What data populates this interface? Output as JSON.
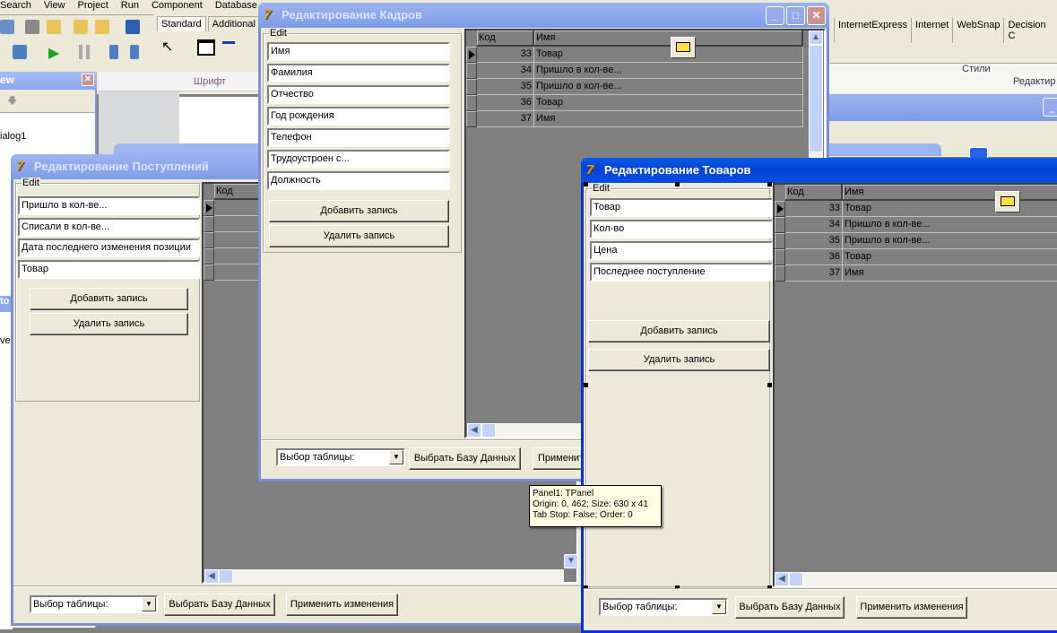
{
  "ide": {
    "menu": [
      "Search",
      "View",
      "Project",
      "Run",
      "Component",
      "Database"
    ],
    "palette_tabs": [
      "Standard",
      "Additional"
    ],
    "palette_tabs_right": [
      "InternetExpress",
      "Internet",
      "WebSnap",
      "Decision C"
    ],
    "tree_title": "ew",
    "tree_item": "ialog1",
    "font_label": "Шрифт",
    "styles_label": "Стили",
    "edit_label": "Редактир",
    "left_fragment_1": "to",
    "left_fragment_2": "ver"
  },
  "windows": {
    "postupleniya": {
      "title": "Редактирование Поступлений",
      "group_label": "Edit",
      "fields": [
        "Пришло в кол-ве...",
        "Списали в кол-ве...",
        "Дата последнего изменения позиции",
        "Товар"
      ],
      "add_button": "Добавить запись",
      "delete_button": "Удалить запись",
      "grid": {
        "columns": [
          "Код"
        ],
        "rows": [
          [
            ""
          ],
          [
            ""
          ],
          [
            ""
          ],
          [
            ""
          ],
          [
            ""
          ]
        ]
      },
      "table_select": "Выбор таблицы:",
      "select_db_button": "Выбрать Базу Данных",
      "apply_button": "Применить изменения"
    },
    "kadry": {
      "title": "Редактирование Кадров",
      "group_label": "Edit",
      "fields": [
        "Имя",
        "Фамилия",
        "Отчество",
        "Год рождения",
        "Телефон",
        "Трудоустроен с...",
        "Должность"
      ],
      "add_button": "Добавить запись",
      "delete_button": "Удалить запись",
      "grid": {
        "columns": [
          "Код",
          "Имя"
        ],
        "rows": [
          [
            "33",
            "Товар"
          ],
          [
            "34",
            "Пришло в кол-ве..."
          ],
          [
            "35",
            "Пришло в кол-ве..."
          ],
          [
            "36",
            "Товар"
          ],
          [
            "37",
            "Имя"
          ]
        ]
      },
      "table_select": "Выбор таблицы:",
      "select_db_button": "Выбрать Базу Данных",
      "apply_button": "Применит"
    },
    "tovary": {
      "title": "Редактирование Товаров",
      "group_label": "Edit",
      "fields": [
        "Товар",
        "Кол-во",
        "Цена",
        "Последнее поступление"
      ],
      "add_button": "Добавить запись",
      "delete_button": "Удалить запись",
      "grid": {
        "columns": [
          "Код",
          "Имя"
        ],
        "rows": [
          [
            "33",
            "Товар"
          ],
          [
            "34",
            "Пришло в кол-ве..."
          ],
          [
            "35",
            "Пришло в кол-ве..."
          ],
          [
            "36",
            "Товар"
          ],
          [
            "37",
            "Имя"
          ]
        ]
      },
      "table_select": "Выбор таблицы:",
      "select_db_button": "Выбрать Базу Данных",
      "apply_button": "Применить изменения"
    }
  },
  "tooltip": {
    "line1": "Panel1: TPanel",
    "line2": "Origin: 0, 462; Size: 630 x 41",
    "line3": "Tab Stop: False; Order: 0"
  },
  "colors": {
    "titlebar_active": "#0343d6",
    "titlebar_inactive": "#7e9ce8",
    "grid_bg": "#808080",
    "window_bg": "#ece9d8",
    "tooltip_bg": "#ffffe1"
  }
}
